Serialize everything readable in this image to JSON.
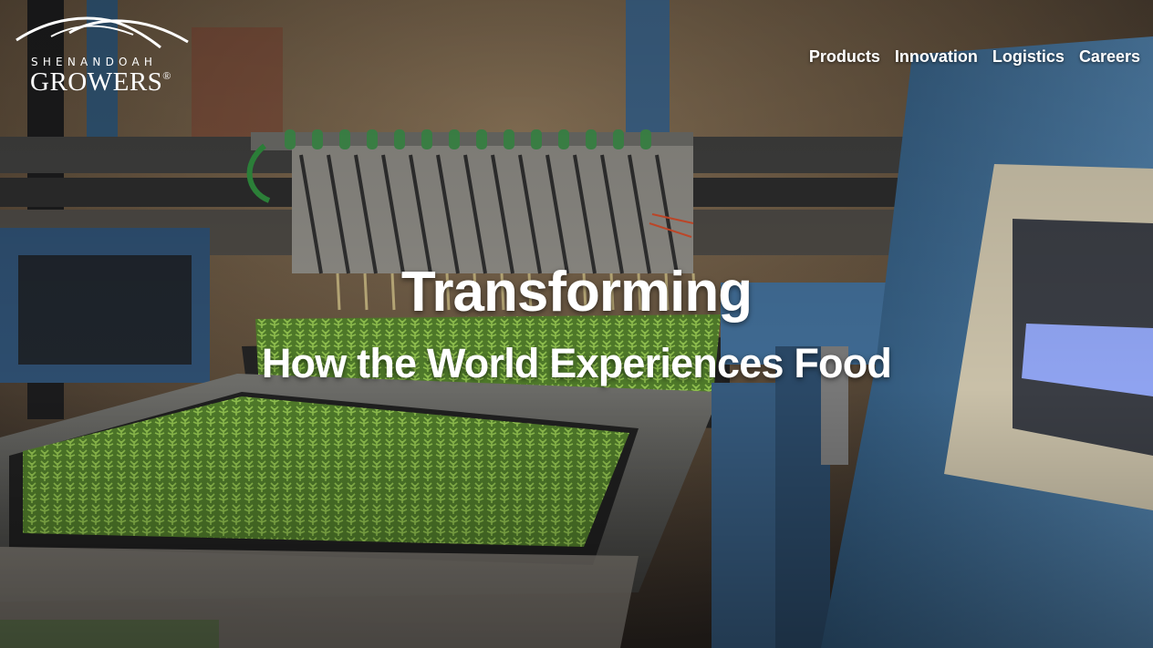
{
  "brand": {
    "name_small": "SHENANDOAH",
    "name_large": "GROWERS",
    "registered": "®"
  },
  "nav": {
    "items": [
      {
        "label": "Products"
      },
      {
        "label": "Innovation"
      },
      {
        "label": "Logistics"
      },
      {
        "label": "Careers"
      }
    ]
  },
  "hero": {
    "title": "Transforming",
    "subtitle": "How the World Experiences Food",
    "background": "greenhouse-seedling-planting-machine-photo"
  },
  "colors": {
    "text": "#ffffff",
    "machine_blue": "#3f6a92",
    "seedling_green": "#6f9a3c"
  }
}
